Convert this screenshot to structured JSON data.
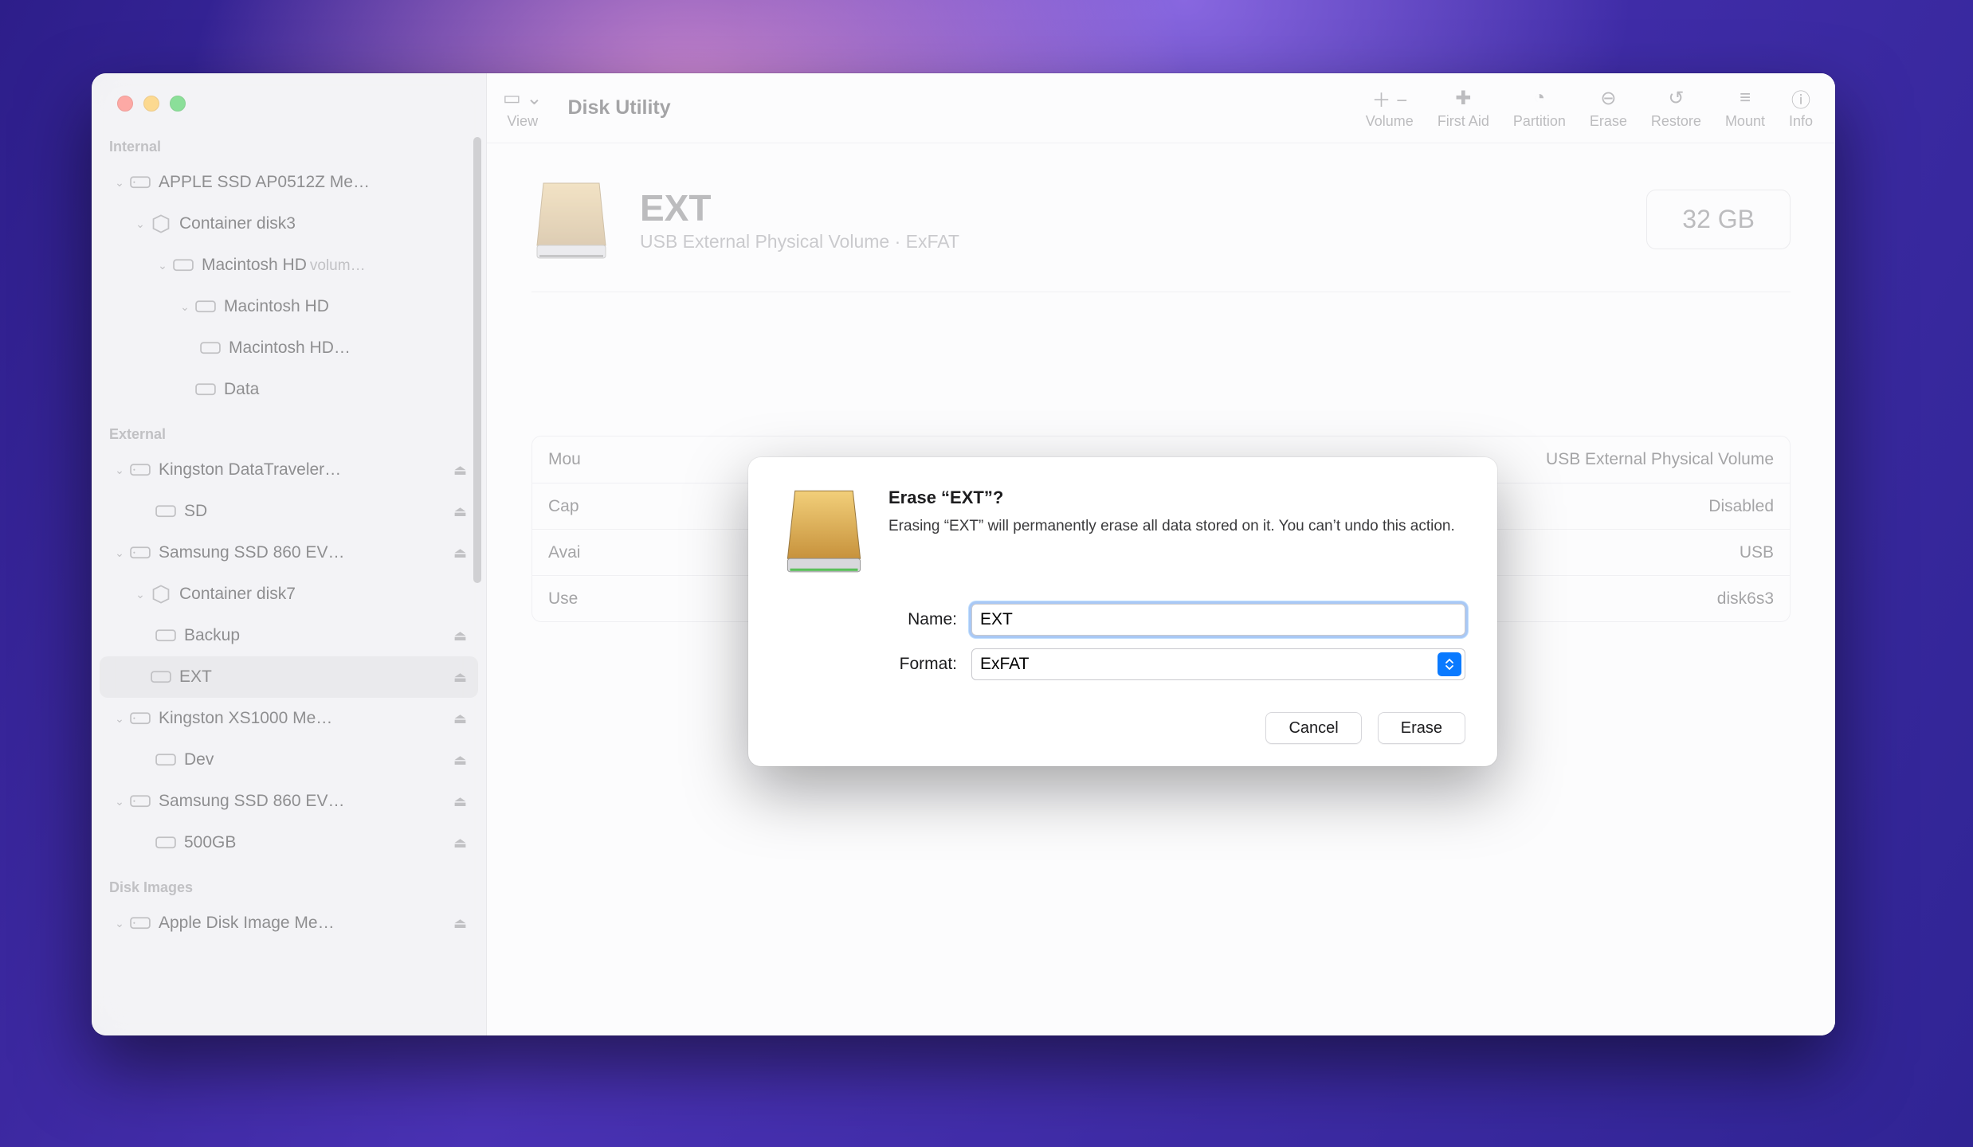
{
  "app": {
    "title": "Disk Utility"
  },
  "toolbar": {
    "view": "View",
    "items": [
      {
        "label": "Volume",
        "icon": "plus-minus"
      },
      {
        "label": "First Aid",
        "icon": "stethoscope"
      },
      {
        "label": "Partition",
        "icon": "pie"
      },
      {
        "label": "Erase",
        "icon": "erase"
      },
      {
        "label": "Restore",
        "icon": "restore"
      },
      {
        "label": "Mount",
        "icon": "mount"
      },
      {
        "label": "Info",
        "icon": "info"
      }
    ]
  },
  "sidebar": {
    "sections": {
      "internal": "Internal",
      "external": "External",
      "disk_images": "Disk Images"
    },
    "internal": [
      {
        "label": "APPLE SSD AP0512Z Me…",
        "type": "disk"
      },
      {
        "label": "Container disk3",
        "type": "container"
      },
      {
        "label": "Macintosh HD",
        "suffix": "volum…",
        "type": "volgroup"
      },
      {
        "label": "Macintosh HD",
        "type": "vol"
      },
      {
        "label": "Macintosh HD…",
        "type": "snap"
      },
      {
        "label": "Data",
        "type": "vol"
      }
    ],
    "external": [
      {
        "label": "Kingston DataTraveler…",
        "type": "disk",
        "eject": true
      },
      {
        "label": "SD",
        "type": "vol",
        "eject": true
      },
      {
        "label": "Samsung SSD 860 EV…",
        "type": "disk",
        "eject": true
      },
      {
        "label": "Container disk7",
        "type": "container"
      },
      {
        "label": "Backup",
        "type": "vol",
        "eject": true
      },
      {
        "label": "EXT",
        "type": "vol",
        "eject": true,
        "selected": true
      },
      {
        "label": "Kingston XS1000 Me…",
        "type": "disk",
        "eject": true
      },
      {
        "label": "Dev",
        "type": "vol",
        "eject": true
      },
      {
        "label": "Samsung SSD 860 EV…",
        "type": "disk",
        "eject": true
      },
      {
        "label": "500GB",
        "type": "vol",
        "eject": true
      }
    ],
    "disk_images": [
      {
        "label": "Apple Disk Image Me…",
        "type": "disk",
        "eject": true
      }
    ]
  },
  "volume": {
    "name": "EXT",
    "subtitle": "USB External Physical Volume · ExFAT",
    "capacity": "32 GB",
    "rows": [
      {
        "k1": "Mou",
        "v1": "",
        "k2": "",
        "v2": "USB External Physical Volume"
      },
      {
        "k1": "Cap",
        "v1": "",
        "k2": "",
        "v2": "Disabled"
      },
      {
        "k1": "Avai",
        "v1": "",
        "k2": "",
        "v2": "USB"
      },
      {
        "k1": "Use",
        "v1": "",
        "k2": "",
        "v2": "disk6s3"
      }
    ]
  },
  "dialog": {
    "title": "Erase “EXT”?",
    "desc": "Erasing “EXT” will permanently erase all data stored on it. You can’t undo this action.",
    "name_label": "Name:",
    "name_value": "EXT",
    "format_label": "Format:",
    "format_value": "ExFAT",
    "cancel": "Cancel",
    "erase": "Erase"
  }
}
